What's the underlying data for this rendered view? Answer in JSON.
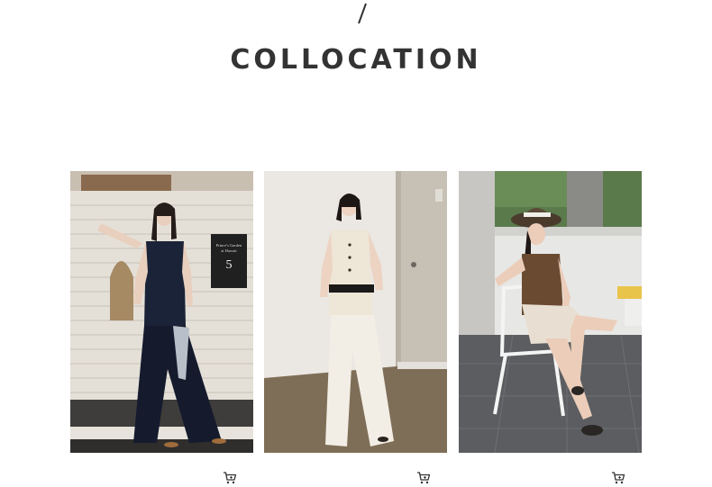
{
  "header": {
    "divider_glyph": "/",
    "title": "COLLOCATION"
  },
  "products": [
    {
      "image": "model-navy-vest-outfit",
      "sign": {
        "line1": "Prince's Garden",
        "line2": "at Hawaii",
        "number": "5"
      },
      "cart_icon": "shopping-cart-icon"
    },
    {
      "image": "model-cream-vest-outfit",
      "cart_icon": "shopping-cart-icon"
    },
    {
      "image": "model-brown-vest-outfit",
      "cart_icon": "shopping-cart-icon"
    }
  ],
  "colors": {
    "title": "#333333",
    "icon": "#333333"
  }
}
